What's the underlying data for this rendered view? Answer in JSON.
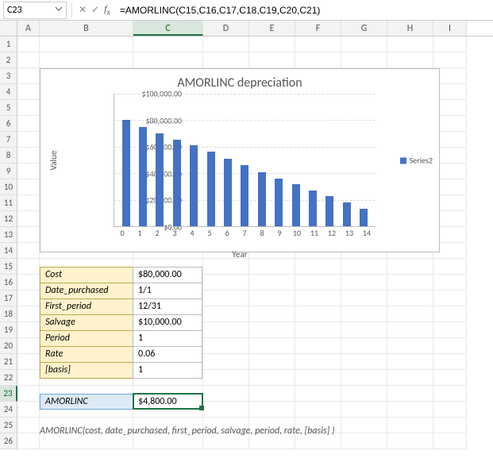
{
  "formula_bar": {
    "cell_ref": "C23",
    "formula": "=AMORLINC(C15,C16,C17,C18,C19,C20,C21)"
  },
  "columns": [
    "A",
    "B",
    "C",
    "D",
    "E",
    "F",
    "G",
    "H",
    "I"
  ],
  "row_count": 26,
  "selected": {
    "col": "C",
    "row": 23
  },
  "chart_data": {
    "type": "bar",
    "title": "AMORLINC depreciation",
    "xlabel": "Year",
    "ylabel": "Value",
    "categories": [
      0,
      1,
      2,
      3,
      4,
      5,
      6,
      7,
      8,
      9,
      10,
      11,
      12,
      13,
      14
    ],
    "values": [
      80000,
      75000,
      70000,
      65000,
      61000,
      56000,
      51000,
      46000,
      41000,
      36000,
      32000,
      27000,
      23000,
      18000,
      13000
    ],
    "ylim": [
      0,
      100000
    ],
    "y_ticks": [
      "$0.00",
      "$20,000.00",
      "$40,000.00",
      "$60,000.00",
      "$80,000.00",
      "$100,000.00"
    ],
    "series_name": "Series2"
  },
  "inputs": {
    "cost_label": "Cost",
    "cost": "$80,000.00",
    "date_purchased_label": "Date_purchased",
    "date_purchased": "1/1",
    "first_period_label": "First_period",
    "first_period": "12/31",
    "salvage_label": "Salvage",
    "salvage": "$10,000.00",
    "period_label": "Period",
    "period": "1",
    "rate_label": "Rate",
    "rate": "0.06",
    "basis_label": "[basis]",
    "basis": "1"
  },
  "result": {
    "label": "AMORLINC",
    "value": "$4,800.00"
  },
  "syntax": "AMORLINC(cost, date_purchased, first_period, salvage, period, rate, [basis] )"
}
